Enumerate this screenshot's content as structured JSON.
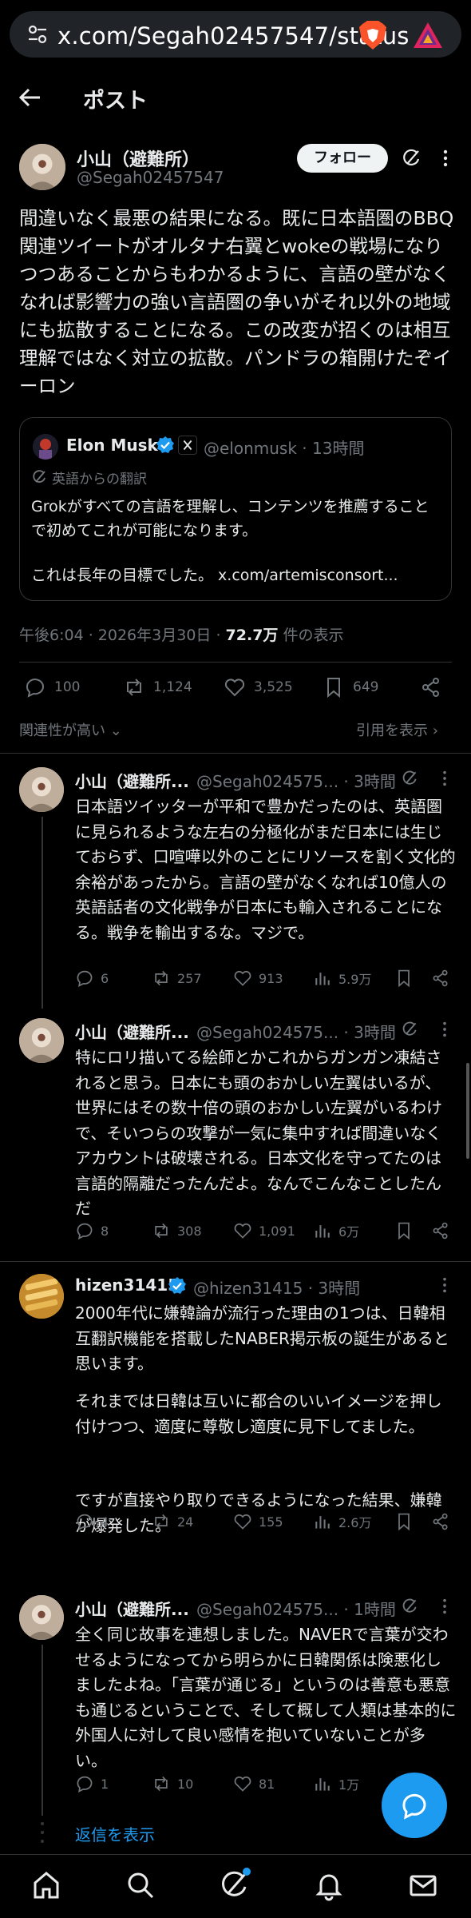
{
  "browser": {
    "url": "x.com/Segah02457547/status"
  },
  "header": {
    "title": "ポスト"
  },
  "main_post": {
    "name": "小山（避難所）",
    "handle": "@Segah02457547",
    "follow_label": "フォロー",
    "text": "間違いなく最悪の結果になる。既に日本語圏のBBQ関連ツイートがオルタナ右翼とwokeの戦場になりつつあることからもわかるように、言語の壁がなくなれば影響力の強い言語圏の争いがそれ以外の地域にも拡散することになる。この改変が招くのは相互理解ではなく対立の拡散。パンドラの箱開けたぞイーロン",
    "quote": {
      "name": "Elon Musk",
      "handle": "@elonmusk · 13時間",
      "translate_note": "英語からの翻訳",
      "text": "Grokがすべての言語を理解し、コンテンツを推薦することで初めてこれが可能になります。",
      "text2": "これは長年の目標でした。 x.com/artemisconsort..."
    },
    "timestamp": "午後6:04 · 2026年3月30日 · ",
    "views": "72.7万",
    "views_suffix": " 件の表示",
    "stats": {
      "replies": "100",
      "reposts": "1,124",
      "likes": "3,525",
      "bookmarks": "649"
    },
    "sort_label": "関連性が高い ⌄",
    "quotes_label": "引用を表示 ›"
  },
  "replies": [
    {
      "name": "小山（避難所...",
      "handle": "@Segah024575... · 3時間",
      "text": "日本語ツイッターが平和で豊かだったのは、英語圏に見られるような左右の分極化がまだ日本には生じておらず、口喧嘩以外のことにリソースを割く文化的余裕があったから。言語の壁がなくなれば10億人の英語話者の文化戦争が日本にも輸入されることになる。戦争を輸出するな。マジで。",
      "replies": "6",
      "reposts": "257",
      "likes": "913",
      "views": "5.9万"
    },
    {
      "name": "小山（避難所...",
      "handle": "@Segah024575... · 3時間",
      "text": "特にロリ描いてる絵師とかこれからガンガン凍結されると思う。日本にも頭のおかしい左翼はいるが、世界にはその数十倍の頭のおかしい左翼がいるわけで、そいつらの攻撃が一気に集中すれば間違いなくアカウントは破壊される。日本文化を守ってたのは言語的隔離だったんだよ。なんでこんなことしたんだ",
      "replies": "8",
      "reposts": "308",
      "likes": "1,091",
      "views": "6万"
    },
    {
      "name": "hizen31415",
      "handle": "@hizen31415 · 3時間",
      "text": "2000年代に嫌韓論が流行った理由の1つは、日韓相互翻訳機能を搭載したNABER掲示板の誕生があると思います。",
      "text2": "それまでは日韓は互いに都合のいいイメージを押し付けつつ、適度に尊敬し適度に見下してました。",
      "text3": "ですが直接やり取りできるようになった結果、嫌韓が爆発した。",
      "replies": "4",
      "reposts": "24",
      "likes": "155",
      "views": "2.6万"
    },
    {
      "name": "小山（避難所...",
      "handle": "@Segah024575... · 1時間",
      "text": "全く同じ故事を連想しました。NAVERで言葉が交わせるようになってから明らかに日韓関係は険悪化しましたよね。「言葉が通じる」というのは善意も悪意も通じるということで、そして概して人類は基本的に外国人に対して良い感情を抱いていないことが多い。",
      "replies": "1",
      "reposts": "10",
      "likes": "81",
      "views": "1万"
    }
  ],
  "show_replies_label": "返信を表示",
  "colors": {
    "accent": "#1d9bf0",
    "text": "#e7e9ea",
    "muted": "#71767b",
    "background": "#000000"
  }
}
